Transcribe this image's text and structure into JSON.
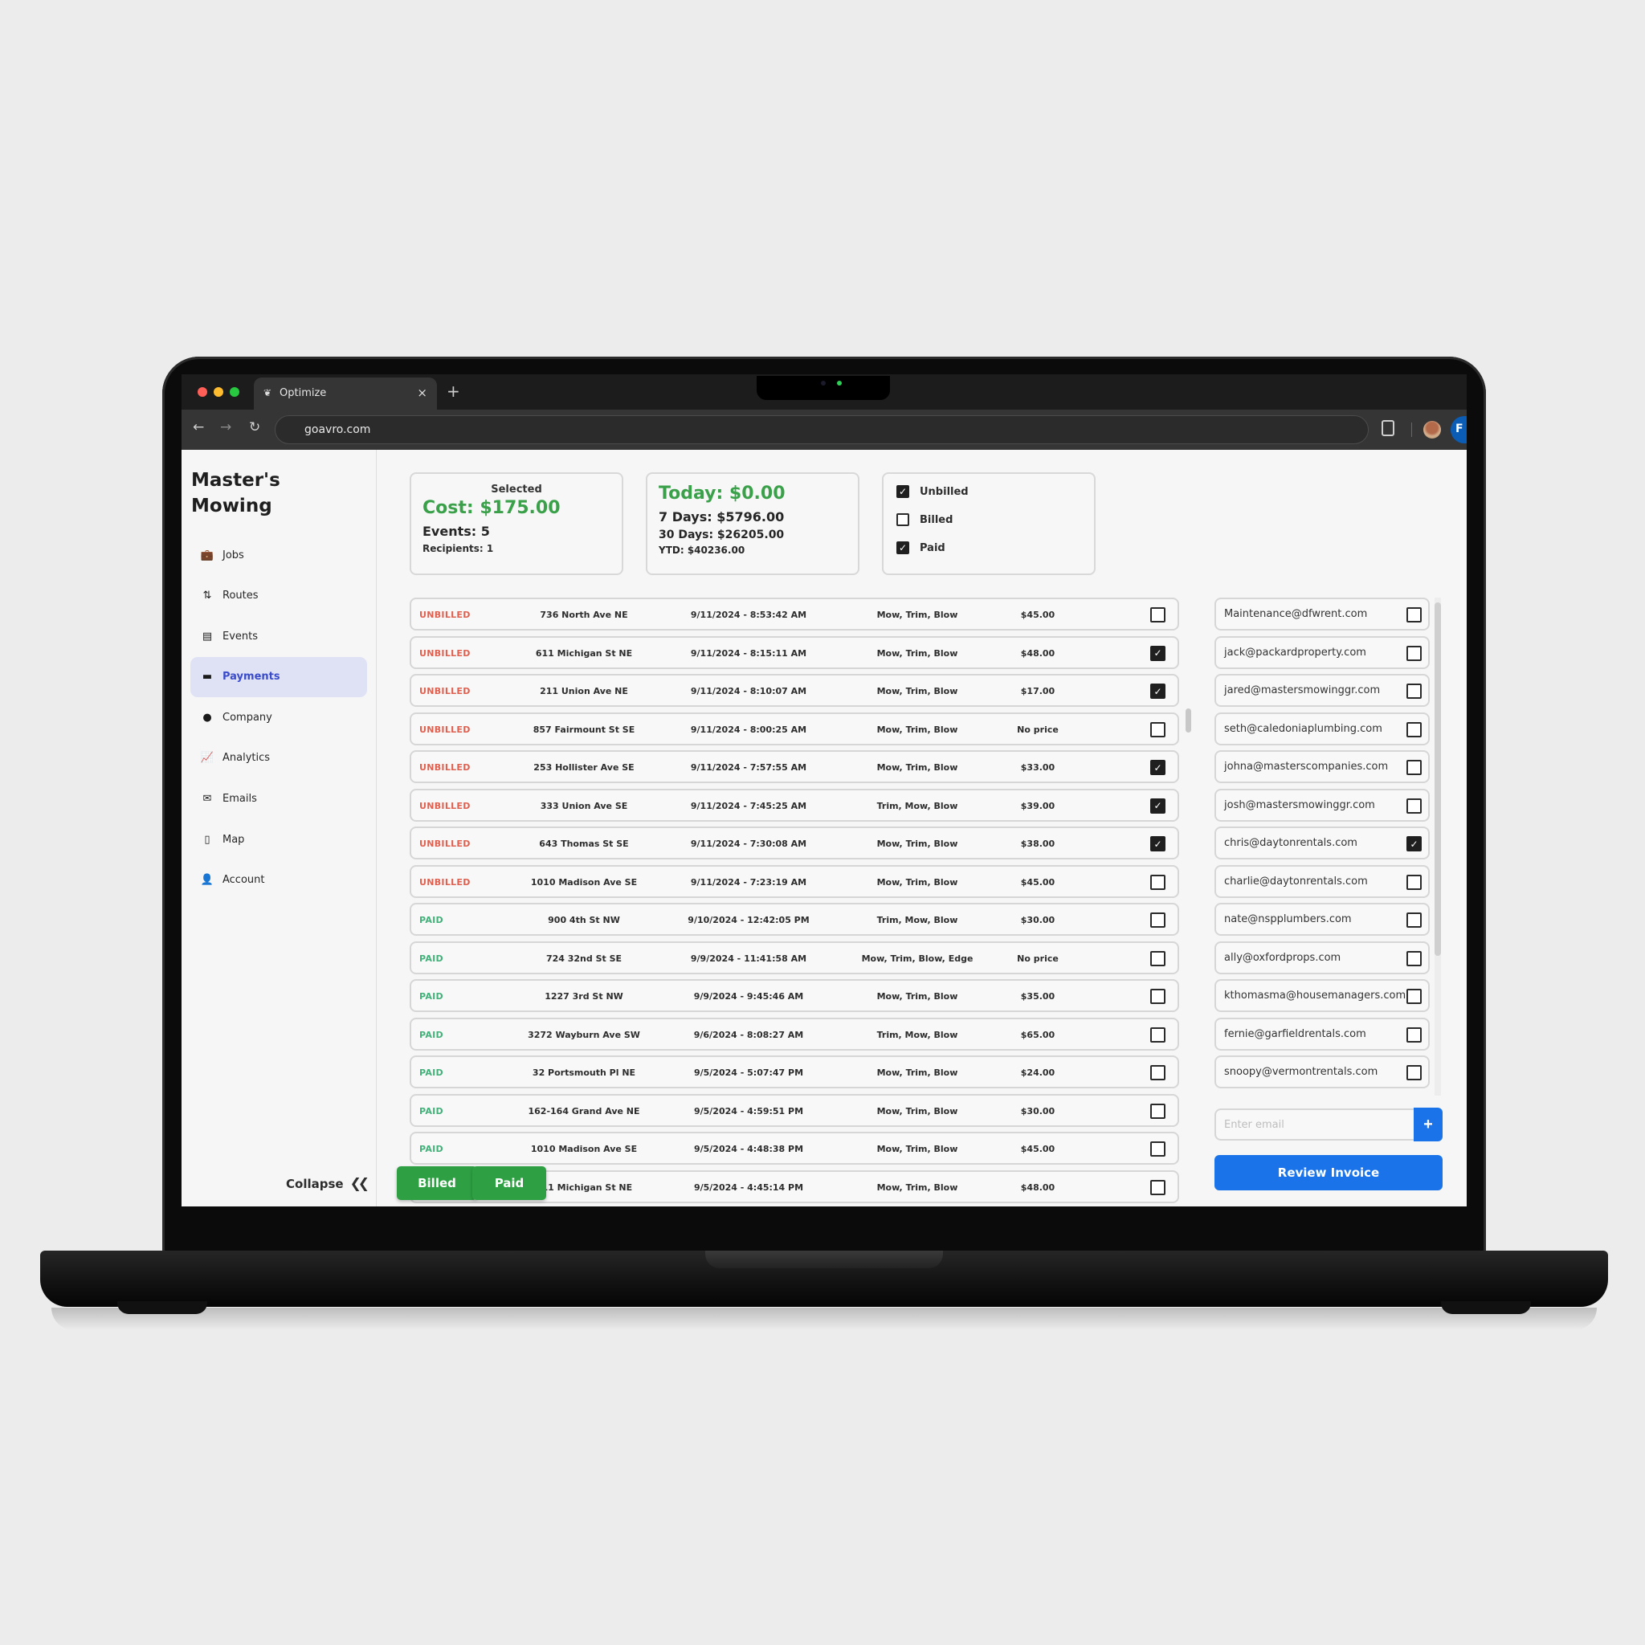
{
  "browser": {
    "tab_title": "Optimize",
    "url": "goavro.com",
    "profile_initial": "F",
    "controls": {
      "back": "←",
      "forward": "→",
      "reload": "↻",
      "close_tab": "×",
      "new_tab": "+"
    },
    "traffic_lights": {
      "close": "#ff5f57",
      "minimize": "#febc2e",
      "maximize": "#28c840"
    }
  },
  "sidebar": {
    "brand": "Master's Mowing",
    "items": [
      {
        "label": "Jobs",
        "icon": "briefcase-icon",
        "glyph": "💼",
        "active": false
      },
      {
        "label": "Routes",
        "icon": "routes-icon",
        "glyph": "⇅",
        "active": false
      },
      {
        "label": "Events",
        "icon": "calendar-icon",
        "glyph": "▤",
        "active": false
      },
      {
        "label": "Payments",
        "icon": "credit-card-icon",
        "glyph": "▬",
        "active": true
      },
      {
        "label": "Company",
        "icon": "info-icon",
        "glyph": "●",
        "active": false
      },
      {
        "label": "Analytics",
        "icon": "chart-icon",
        "glyph": "📈",
        "active": false
      },
      {
        "label": "Emails",
        "icon": "envelope-icon",
        "glyph": "✉",
        "active": false
      },
      {
        "label": "Map",
        "icon": "map-icon",
        "glyph": "▯",
        "active": false
      },
      {
        "label": "Account",
        "icon": "user-icon",
        "glyph": "👤",
        "active": false
      }
    ],
    "collapse_label": "Collapse",
    "collapse_glyph": "«"
  },
  "summary": {
    "selected_label": "Selected",
    "cost": "Cost: $175.00",
    "events": "Events: 5",
    "recipients": "Recipients: 1"
  },
  "totals": {
    "today": "Today: $0.00",
    "days7": "7 Days: $5796.00",
    "days30": "30 Days: $26205.00",
    "ytd": "YTD: $40236.00"
  },
  "filters": [
    {
      "label": "Unbilled",
      "checked": true
    },
    {
      "label": "Billed",
      "checked": false
    },
    {
      "label": "Paid",
      "checked": true
    }
  ],
  "events": [
    {
      "status": "UNBILLED",
      "address": "736 North Ave NE",
      "datetime": "9/11/2024 - 8:53:42 AM",
      "services": "Mow, Trim, Blow",
      "price": "$45.00",
      "checked": false
    },
    {
      "status": "UNBILLED",
      "address": "611 Michigan St NE",
      "datetime": "9/11/2024 - 8:15:11 AM",
      "services": "Mow, Trim, Blow",
      "price": "$48.00",
      "checked": true
    },
    {
      "status": "UNBILLED",
      "address": "211 Union Ave NE",
      "datetime": "9/11/2024 - 8:10:07 AM",
      "services": "Mow, Trim, Blow",
      "price": "$17.00",
      "checked": true
    },
    {
      "status": "UNBILLED",
      "address": "857 Fairmount St SE",
      "datetime": "9/11/2024 - 8:00:25 AM",
      "services": "Mow, Trim, Blow",
      "price": "No price",
      "checked": false
    },
    {
      "status": "UNBILLED",
      "address": "253 Hollister Ave SE",
      "datetime": "9/11/2024 - 7:57:55 AM",
      "services": "Mow, Trim, Blow",
      "price": "$33.00",
      "checked": true
    },
    {
      "status": "UNBILLED",
      "address": "333 Union Ave SE",
      "datetime": "9/11/2024 - 7:45:25 AM",
      "services": "Trim, Mow, Blow",
      "price": "$39.00",
      "checked": true
    },
    {
      "status": "UNBILLED",
      "address": "643 Thomas St SE",
      "datetime": "9/11/2024 - 7:30:08 AM",
      "services": "Mow, Trim, Blow",
      "price": "$38.00",
      "checked": true
    },
    {
      "status": "UNBILLED",
      "address": "1010 Madison Ave SE",
      "datetime": "9/11/2024 - 7:23:19 AM",
      "services": "Mow, Trim, Blow",
      "price": "$45.00",
      "checked": false
    },
    {
      "status": "PAID",
      "address": "900 4th St NW",
      "datetime": "9/10/2024 - 12:42:05 PM",
      "services": "Trim, Mow, Blow",
      "price": "$30.00",
      "checked": false
    },
    {
      "status": "PAID",
      "address": "724 32nd St SE",
      "datetime": "9/9/2024 - 11:41:58 AM",
      "services": "Mow, Trim, Blow, Edge",
      "price": "No price",
      "checked": false
    },
    {
      "status": "PAID",
      "address": "1227 3rd St NW",
      "datetime": "9/9/2024 - 9:45:46 AM",
      "services": "Mow, Trim, Blow",
      "price": "$35.00",
      "checked": false
    },
    {
      "status": "PAID",
      "address": "3272 Wayburn Ave SW",
      "datetime": "9/6/2024 - 8:08:27 AM",
      "services": "Trim, Mow, Blow",
      "price": "$65.00",
      "checked": false
    },
    {
      "status": "PAID",
      "address": "32 Portsmouth Pl NE",
      "datetime": "9/5/2024 - 5:07:47 PM",
      "services": "Mow, Trim, Blow",
      "price": "$24.00",
      "checked": false
    },
    {
      "status": "PAID",
      "address": "162-164 Grand Ave NE",
      "datetime": "9/5/2024 - 4:59:51 PM",
      "services": "Mow, Trim, Blow",
      "price": "$30.00",
      "checked": false
    },
    {
      "status": "PAID",
      "address": "1010 Madison Ave SE",
      "datetime": "9/5/2024 - 4:48:38 PM",
      "services": "Mow, Trim, Blow",
      "price": "$45.00",
      "checked": false
    },
    {
      "status": "PAID",
      "address": "611 Michigan St NE",
      "datetime": "9/5/2024 - 4:45:14 PM",
      "services": "Mow, Trim, Blow",
      "price": "$48.00",
      "checked": false
    }
  ],
  "recipients": [
    {
      "email": "Maintenance@dfwrent.com",
      "checked": false
    },
    {
      "email": "jack@packardproperty.com",
      "checked": false
    },
    {
      "email": "jared@mastersmowinggr.com",
      "checked": false
    },
    {
      "email": "seth@caledoniaplumbing.com",
      "checked": false
    },
    {
      "email": "johna@masterscompanies.com",
      "checked": false
    },
    {
      "email": "josh@mastersmowinggr.com",
      "checked": false
    },
    {
      "email": "chris@daytonrentals.com",
      "checked": true
    },
    {
      "email": "charlie@daytonrentals.com",
      "checked": false
    },
    {
      "email": "nate@nspplumbers.com",
      "checked": false
    },
    {
      "email": "ally@oxfordprops.com",
      "checked": false
    },
    {
      "email": "kthomasma@housemanagers.com",
      "checked": false
    },
    {
      "email": "fernie@garfieldrentals.com",
      "checked": false
    },
    {
      "email": "snoopy@vermontrentals.com",
      "checked": false
    }
  ],
  "email_input": {
    "value": "",
    "placeholder": "Enter email",
    "add_label": "+"
  },
  "actions": {
    "review_invoice": "Review Invoice",
    "billed": "Billed",
    "paid": "Paid"
  },
  "colors": {
    "accent_blue": "#1a73e8",
    "success_green": "#2ea043",
    "amount_green": "#3aa14a",
    "unbilled_red": "#e0604f",
    "paid_green": "#43b07a",
    "active_nav_bg": "#dfe2f5",
    "active_nav_text": "#3a4ccb"
  }
}
